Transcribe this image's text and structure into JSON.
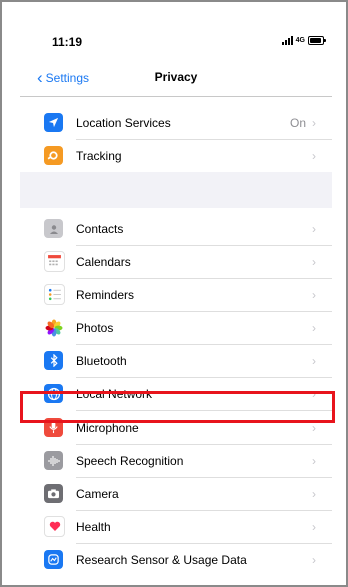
{
  "status": {
    "time": "11:19",
    "network": "4G"
  },
  "nav": {
    "back_label": "Settings",
    "title": "Privacy"
  },
  "section1": [
    {
      "label": "Location Services",
      "value": "On",
      "icon": "location-arrow-icon",
      "color": "#1a78f2"
    },
    {
      "label": "Tracking",
      "value": "",
      "icon": "tracking-icon",
      "color": "#f59a23"
    }
  ],
  "section2": [
    {
      "label": "Contacts",
      "icon": "contacts-icon",
      "color": "#c8c8cc"
    },
    {
      "label": "Calendars",
      "icon": "calendar-icon",
      "color": "#ffffff"
    },
    {
      "label": "Reminders",
      "icon": "reminders-icon",
      "color": "#ffffff"
    },
    {
      "label": "Photos",
      "icon": "photos-icon",
      "color": "#ffffff"
    },
    {
      "label": "Bluetooth",
      "icon": "bluetooth-icon",
      "color": "#1a78f2"
    },
    {
      "label": "Local Network",
      "icon": "globe-icon",
      "color": "#1a78f2"
    },
    {
      "label": "Microphone",
      "icon": "microphone-icon",
      "color": "#ef4a3c"
    },
    {
      "label": "Speech Recognition",
      "icon": "waveform-icon",
      "color": "#9b9ba0"
    },
    {
      "label": "Camera",
      "icon": "camera-icon",
      "color": "#6e6e73"
    },
    {
      "label": "Health",
      "icon": "heart-icon",
      "color": "#ffffff"
    },
    {
      "label": "Research Sensor & Usage Data",
      "icon": "research-icon",
      "color": "#1a78f2"
    }
  ],
  "chevron": "›",
  "highlight_color": "#e8141c"
}
